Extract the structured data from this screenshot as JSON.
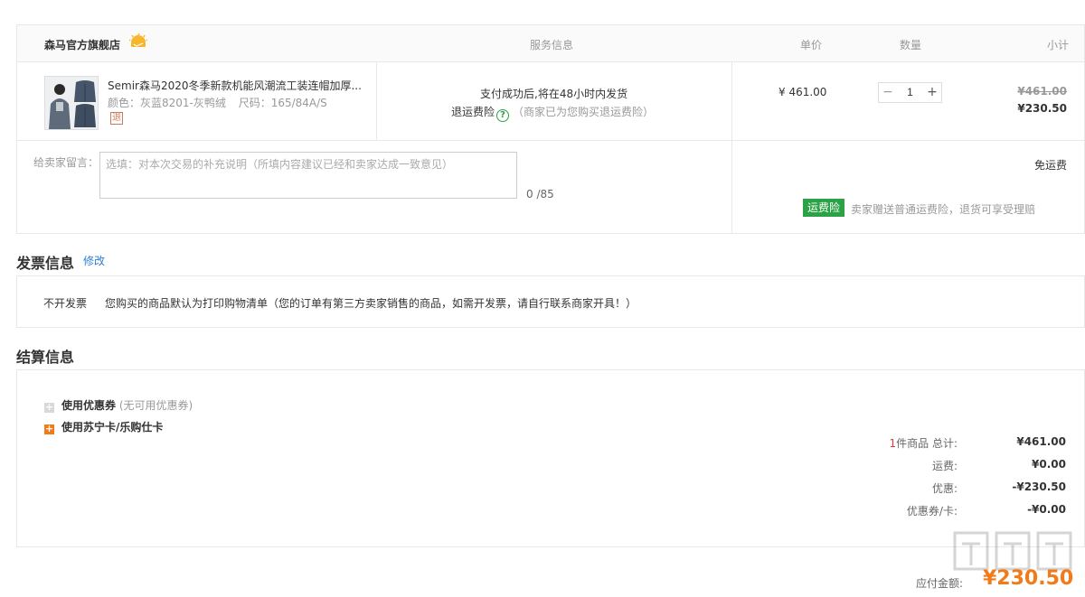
{
  "order": {
    "shop_name": "森马官方旗舰店",
    "headers": {
      "service": "服务信息",
      "price": "单价",
      "quantity": "数量",
      "subtotal": "小计"
    },
    "item": {
      "title": "Semir森马2020冬季新款机能风潮流工装连帽加厚...",
      "color_label": "颜色：灰蓝8201-灰鸭绒",
      "size_label": "尺码：165/84A/S",
      "return_badge": "退",
      "shipping_note": "支付成功后,将在48小时内发货",
      "return_insurance_label": "退运费险",
      "help_glyph": "?",
      "return_insurance_note": "（商家已为您购买退运费险）",
      "unit_price": "¥ 461.00",
      "quantity_minus": "−",
      "quantity": "1",
      "quantity_plus": "+",
      "subtotal_original": "¥461.00",
      "subtotal_final": "¥230.50"
    },
    "message": {
      "label": "给卖家留言：",
      "placeholder": "选填：对本次交易的补充说明（所填内容建议已经和卖家达成一致意见）",
      "count": "0 /85"
    },
    "shipping": {
      "fee_text": "免运费",
      "insurance_badge": "运费险",
      "insurance_note": "卖家赠送普通运费险，退货可享受理赔"
    }
  },
  "invoice": {
    "title": "发票信息",
    "edit_label": "修改",
    "type": "不开发票",
    "description": "您购买的商品默认为打印购物清单（您的订单有第三方卖家销售的商品，如需开发票，请自行联系商家开具！）"
  },
  "settlement": {
    "title": "结算信息",
    "coupon_option": {
      "icon_glyph": "+",
      "label": "使用优惠券",
      "note": "(无可用优惠券)"
    },
    "card_option": {
      "icon_glyph": "+",
      "label": "使用苏宁卡/乐购仕卡"
    },
    "summary": {
      "item_count": "1",
      "total_label": "件商品 总计:",
      "total_value": "¥461.00",
      "shipping_label": "运费:",
      "shipping_value": "¥0.00",
      "discount_label": "优惠:",
      "discount_value": "-¥230.50",
      "coupon_label": "优惠券/卡:",
      "coupon_value": "-¥0.00"
    },
    "payable_label": "应付金额:",
    "payable_value": "¥230.50"
  },
  "colors": {
    "accent_orange": "#f27a18",
    "green": "#2ba245",
    "link_blue": "#2e7ed6",
    "red": "#e4393c"
  }
}
